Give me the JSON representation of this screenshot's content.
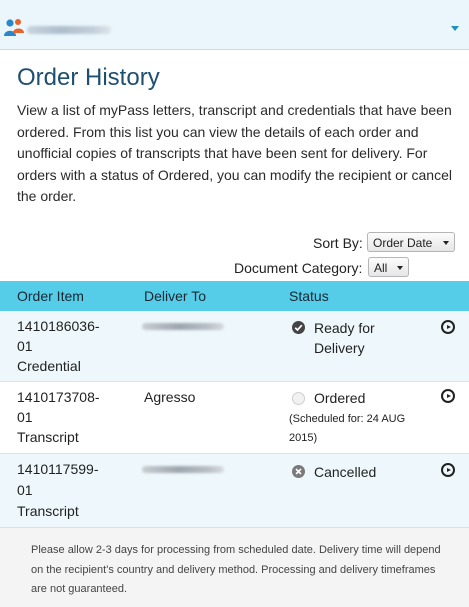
{
  "header": {
    "institution_name_hidden": ""
  },
  "page": {
    "title": "Order History",
    "intro": "View a list of myPass letters, transcript and credentials that have been ordered. From this list you can view the details of each order and unofficial copies of transcripts that have been sent for delivery. For orders with a status of Ordered, you can modify the recipient or cancel the order."
  },
  "filters": {
    "sort_by_label": "Sort By:",
    "sort_by_value": "Order Date",
    "doc_category_label": "Document Category:",
    "doc_category_value": "All"
  },
  "table": {
    "columns": [
      "Order Item",
      "Deliver To",
      "Status"
    ],
    "rows": [
      {
        "id1": "1410186036-",
        "id2": "01",
        "type": "Credential",
        "deliver_to": "",
        "status": "Ready for",
        "status2": "Delivery",
        "note1": "",
        "note2": ""
      },
      {
        "id1": "1410173708-",
        "id2": "01",
        "type": "Transcript",
        "deliver_to": "Agresso",
        "status": "Ordered",
        "status2": "",
        "note1": "(Scheduled for: 24 AUG",
        "note2": "2015)"
      },
      {
        "id1": "1410117599-",
        "id2": "01",
        "type": "Transcript",
        "deliver_to": "",
        "status": "Cancelled",
        "status2": "",
        "note1": "",
        "note2": ""
      }
    ]
  },
  "footer": {
    "text": "Please allow 2-3 days for processing from scheduled date. Delivery time will depend on the recipient's country and delivery method. Processing and delivery timeframes are not guaranteed."
  },
  "icons": {
    "logo": "people-logo-icon",
    "menu": "chevron-down-icon",
    "ready": "check-circle-icon",
    "ordered": "empty-circle-icon",
    "cancelled": "x-circle-icon",
    "row_action": "play-circle-icon"
  },
  "colors": {
    "table_header": "#55cde8",
    "title": "#1f4f6f",
    "topbar": "#eaf6fb"
  }
}
